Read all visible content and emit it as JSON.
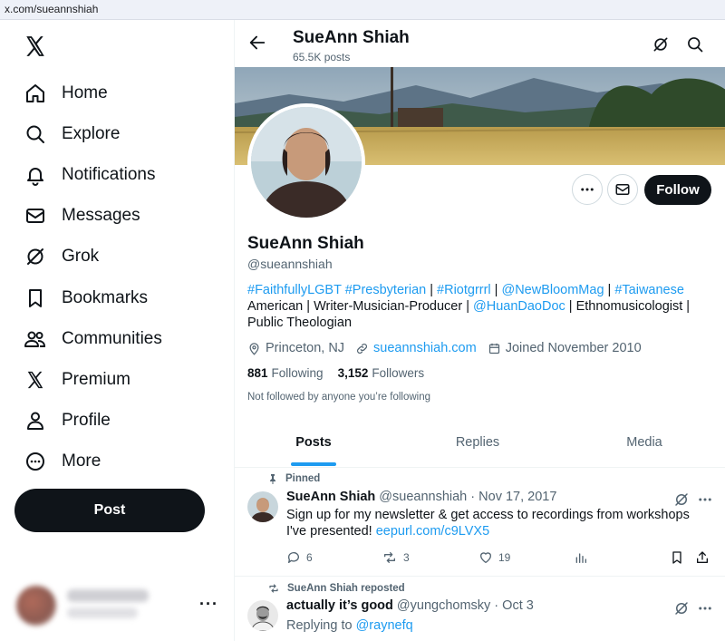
{
  "browser": {
    "url": "x.com/sueannshiah"
  },
  "sidebar": {
    "items": [
      {
        "label": "Home",
        "icon": "home-icon"
      },
      {
        "label": "Explore",
        "icon": "search-icon"
      },
      {
        "label": "Notifications",
        "icon": "bell-icon"
      },
      {
        "label": "Messages",
        "icon": "envelope-icon"
      },
      {
        "label": "Grok",
        "icon": "grok-icon"
      },
      {
        "label": "Bookmarks",
        "icon": "bookmark-icon"
      },
      {
        "label": "Communities",
        "icon": "people-icon"
      },
      {
        "label": "Premium",
        "icon": "x-logo-icon"
      },
      {
        "label": "Profile",
        "icon": "person-icon"
      },
      {
        "label": "More",
        "icon": "more-circle-icon"
      }
    ],
    "post_label": "Post",
    "account_more": "···"
  },
  "header": {
    "name": "SueAnn Shiah",
    "posts": "65.5K posts"
  },
  "profile": {
    "name": "SueAnn Shiah",
    "handle": "@sueannshiah",
    "follow_label": "Follow",
    "bio": {
      "tag1": "#FaithfullyLGBT",
      "tag2": "#Presbyterian",
      "sep1": " | ",
      "tag3": "#Riotgrrrl",
      "sep2": " | ",
      "mention1": "@NewBloomMag",
      "sep3": " | ",
      "tag4": "#Taiwanese",
      "text1": "American | Writer-Musician-Producer | ",
      "mention2": "@HuanDaoDoc",
      "text2": " | Ethnomusicologist | Public Theologian"
    },
    "location": "Princeton, NJ",
    "website": "sueannshiah.com",
    "joined": "Joined November 2010",
    "following_count": "881",
    "following_label": "Following",
    "followers_count": "3,152",
    "followers_label": "Followers",
    "not_followed": "Not followed by anyone you’re following"
  },
  "tabs": [
    {
      "label": "Posts",
      "active": true
    },
    {
      "label": "Replies",
      "active": false
    },
    {
      "label": "Media",
      "active": false
    }
  ],
  "tweets": [
    {
      "context": "Pinned",
      "name": "SueAnn Shiah",
      "handle": "@sueannshiah",
      "dot": " · ",
      "date": "Nov 17, 2017",
      "text": "Sign up for my newsletter & get access to recordings from workshops I've presented! ",
      "link": "eepurl.com/c9LVX5",
      "replies": "6",
      "reposts": "3",
      "likes": "19"
    },
    {
      "context": "SueAnn Shiah reposted",
      "name": "actually it’s good",
      "handle": "@yungchomsky",
      "dot": " · ",
      "date": "Oct 3",
      "replying_prefix": "Replying to ",
      "replying_to": "@raynefq"
    }
  ],
  "colors": {
    "accent": "#1d9bf0",
    "text": "#0f1419",
    "muted": "#536471",
    "button_dark": "#0f1419"
  }
}
